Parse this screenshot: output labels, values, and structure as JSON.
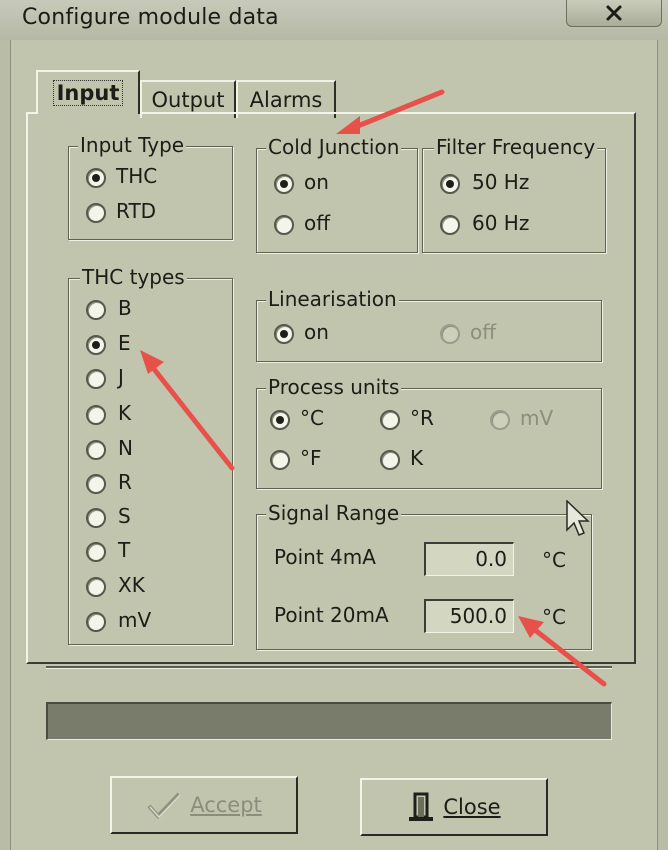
{
  "window": {
    "title": "Configure module data",
    "close_glyph": "X"
  },
  "tabs": [
    {
      "label": "Input",
      "active": true
    },
    {
      "label": "Output",
      "active": false
    },
    {
      "label": "Alarms",
      "active": false
    }
  ],
  "input_type": {
    "label": "Input Type",
    "options": [
      {
        "label": "THC",
        "selected": true
      },
      {
        "label": "RTD",
        "selected": false
      }
    ]
  },
  "cold_junction": {
    "label": "Cold Junction",
    "options": [
      {
        "label": "on",
        "selected": true
      },
      {
        "label": "off",
        "selected": false
      }
    ]
  },
  "filter_frequency": {
    "label": "Filter Frequency",
    "options": [
      {
        "label": "50 Hz",
        "selected": true
      },
      {
        "label": "60 Hz",
        "selected": false
      }
    ]
  },
  "thc_types": {
    "label": "THC types",
    "options": [
      {
        "label": "B",
        "selected": false
      },
      {
        "label": "E",
        "selected": true
      },
      {
        "label": "J",
        "selected": false
      },
      {
        "label": "K",
        "selected": false
      },
      {
        "label": "N",
        "selected": false
      },
      {
        "label": "R",
        "selected": false
      },
      {
        "label": "S",
        "selected": false
      },
      {
        "label": "T",
        "selected": false
      },
      {
        "label": "XK",
        "selected": false
      },
      {
        "label": "mV",
        "selected": false
      }
    ]
  },
  "linearisation": {
    "label": "Linearisation",
    "options": [
      {
        "label": "on",
        "selected": true
      },
      {
        "label": "off",
        "selected": false,
        "disabled": true
      }
    ]
  },
  "process_units": {
    "label": "Process units",
    "options": [
      {
        "label": "°C",
        "selected": true
      },
      {
        "label": "°R",
        "selected": false
      },
      {
        "label": "mV",
        "selected": false,
        "disabled": true
      },
      {
        "label": "°F",
        "selected": false
      },
      {
        "label": "K",
        "selected": false
      }
    ]
  },
  "signal_range": {
    "label": "Signal Range",
    "point_4ma": {
      "label": "Point 4mA",
      "value": "0.0",
      "unit": "°C"
    },
    "point_20ma": {
      "label": "Point 20mA",
      "value": "500.0",
      "unit": "°C"
    }
  },
  "buttons": {
    "accept": {
      "label": "Accept",
      "disabled": true,
      "icon": "checkmark-icon"
    },
    "close": {
      "label": "Close",
      "icon": "door-exit-icon"
    }
  },
  "colors": {
    "annotation_arrow": "#e8504a",
    "panel": "#c2c5ae",
    "progress": "#797c6b"
  }
}
